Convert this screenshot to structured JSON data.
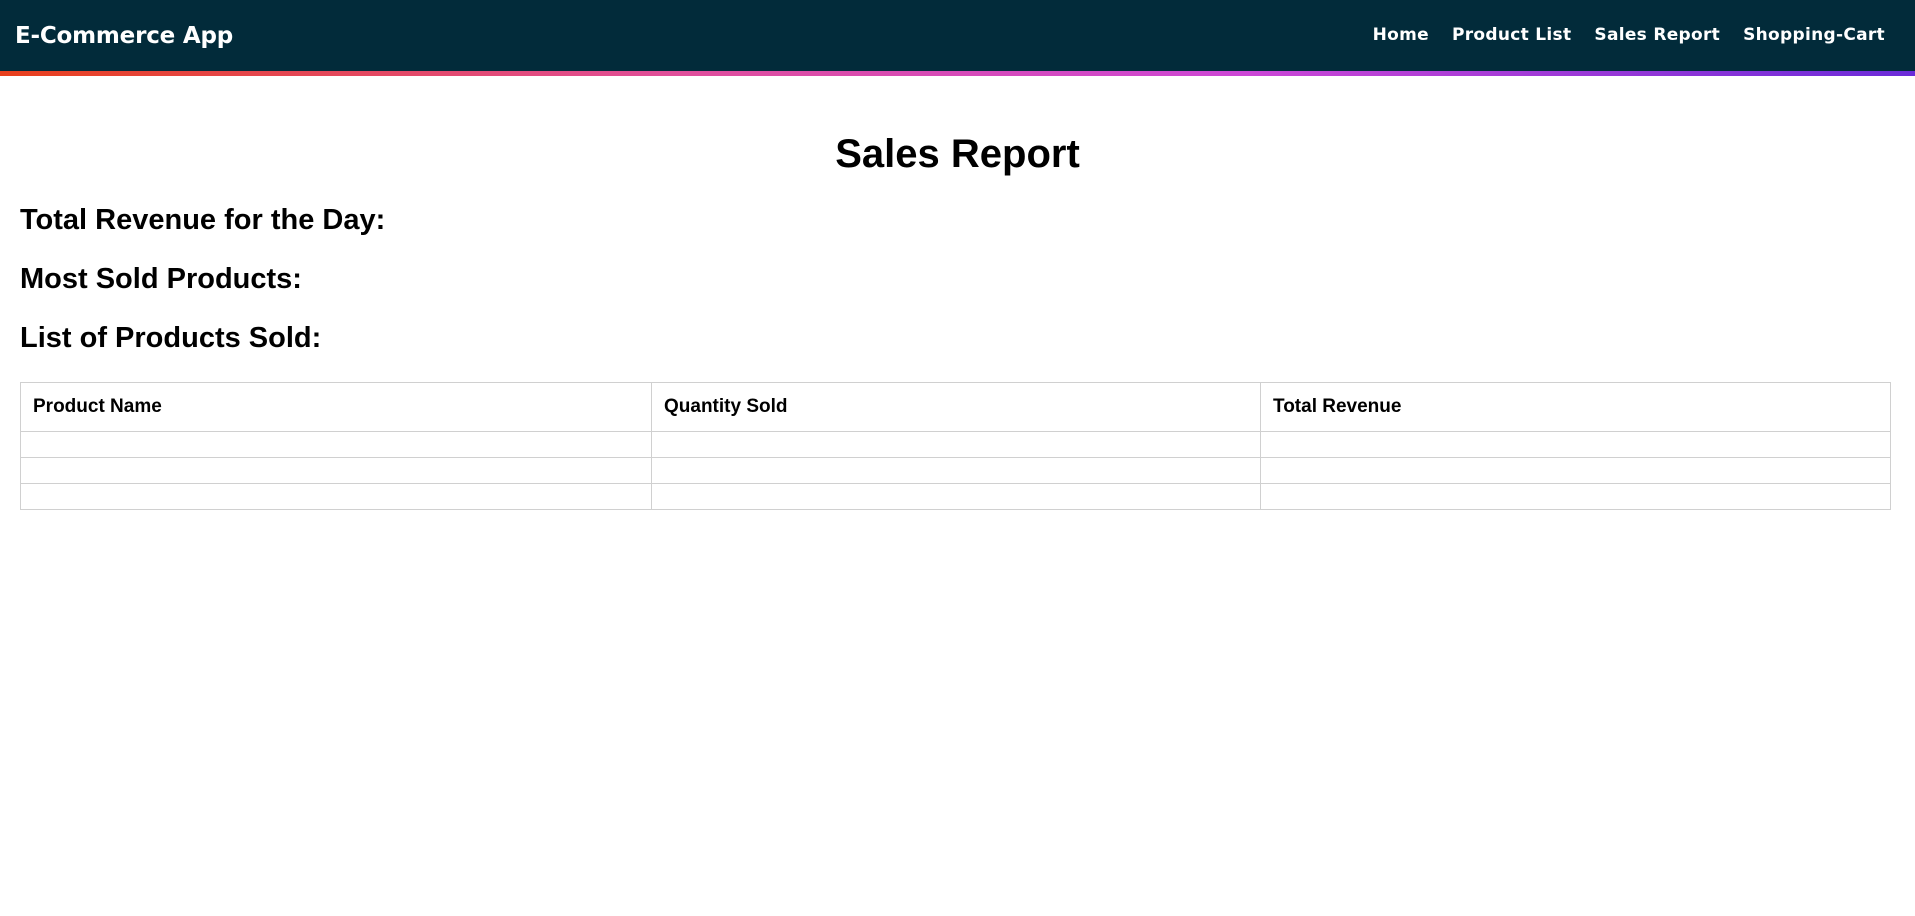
{
  "navbar": {
    "brand": "E-Commerce App",
    "links": [
      {
        "label": "Home"
      },
      {
        "label": "Product List"
      },
      {
        "label": "Sales Report"
      },
      {
        "label": "Shopping-Cart"
      }
    ],
    "background": "#022b3a"
  },
  "page": {
    "title": "Sales Report",
    "total_revenue_label": "Total Revenue for the Day:",
    "most_sold_label": "Most Sold Products:",
    "list_label": "List of Products Sold:"
  },
  "table": {
    "headers": [
      "Product Name",
      "Quantity Sold",
      "Total Revenue"
    ],
    "rows": [
      [
        "",
        "",
        ""
      ],
      [
        "",
        "",
        ""
      ],
      [
        "",
        "",
        ""
      ]
    ]
  }
}
